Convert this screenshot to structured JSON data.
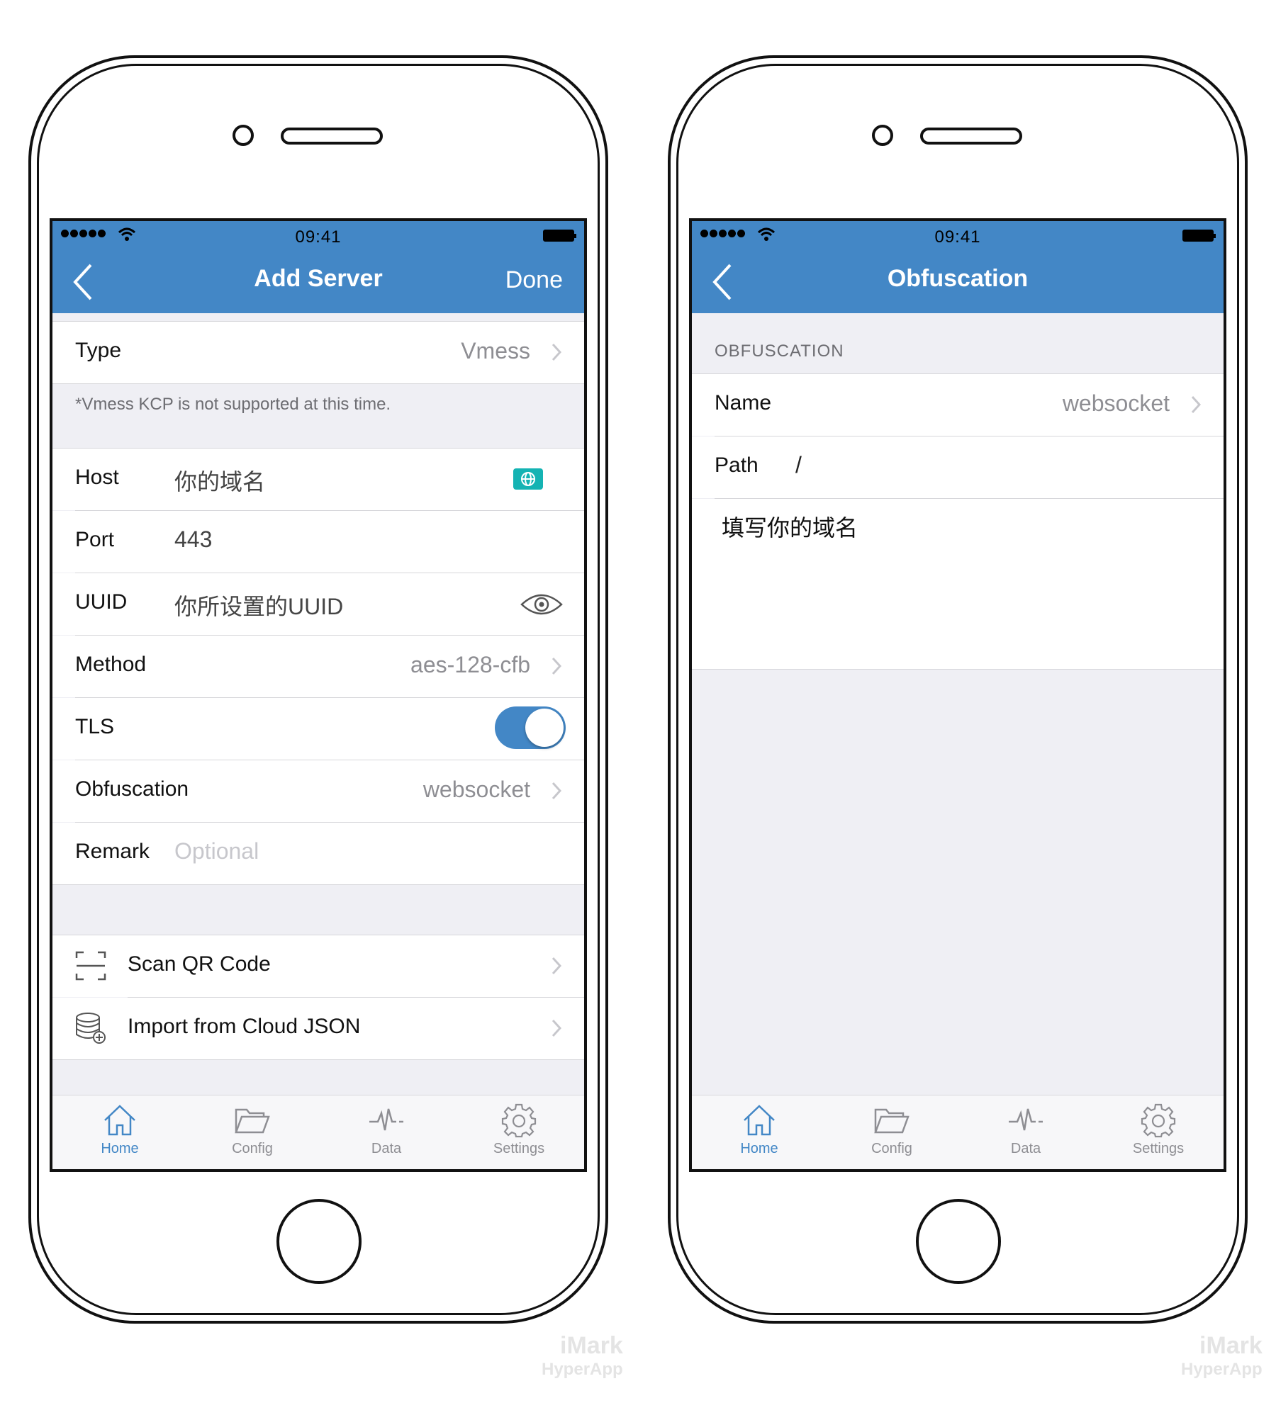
{
  "status": {
    "time": "09:41"
  },
  "left": {
    "nav": {
      "title": "Add Server",
      "done": "Done"
    },
    "type": {
      "label": "Type",
      "value": "Vmess"
    },
    "note": "*Vmess KCP is not supported at this time.",
    "host": {
      "label": "Host",
      "value": "你的域名"
    },
    "port": {
      "label": "Port",
      "value": "443"
    },
    "uuid": {
      "label": "UUID",
      "value": "你所设置的UUID"
    },
    "method": {
      "label": "Method",
      "value": "aes-128-cfb"
    },
    "tls": {
      "label": "TLS",
      "enabled": true
    },
    "obfuscation": {
      "label": "Obfuscation",
      "value": "websocket"
    },
    "remark": {
      "label": "Remark",
      "placeholder": "Optional"
    },
    "scan": {
      "label": "Scan QR Code"
    },
    "import": {
      "label": "Import from Cloud JSON"
    }
  },
  "right": {
    "nav": {
      "title": "Obfuscation"
    },
    "section_header": "OBFUSCATION",
    "name": {
      "label": "Name",
      "value": "websocket"
    },
    "path": {
      "label": "Path",
      "value": "/"
    },
    "text": "填写你的域名"
  },
  "tabs": [
    {
      "label": "Home",
      "icon": "home-icon",
      "active": true
    },
    {
      "label": "Config",
      "icon": "folder-icon",
      "active": false
    },
    {
      "label": "Data",
      "icon": "pulse-icon",
      "active": false
    },
    {
      "label": "Settings",
      "icon": "gear-icon",
      "active": false
    }
  ],
  "watermark": {
    "main": "iMark",
    "sub": "HyperApp"
  },
  "colors": {
    "accent": "#4387c6",
    "globe": "#14b3b3",
    "background": "#efeff4"
  }
}
